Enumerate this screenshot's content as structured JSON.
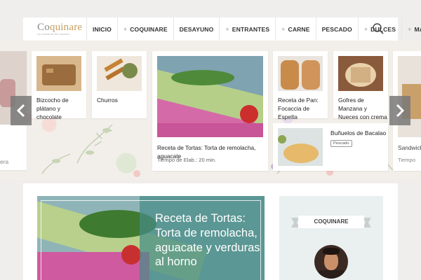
{
  "header": {
    "logo_text_1": "Co",
    "logo_text_2": "quinare",
    "logo_tagline": "La Cocina de Mi Cocinero",
    "nav": [
      {
        "label": "INICIO",
        "plus": false
      },
      {
        "label": "COQUINARE",
        "plus": true
      },
      {
        "label": "DESAYUNO",
        "plus": false
      },
      {
        "label": "ENTRANTES",
        "plus": true
      },
      {
        "label": "CARNE",
        "plus": true
      },
      {
        "label": "PESCADO",
        "plus": false
      },
      {
        "label": "DULCES",
        "plus": true
      },
      {
        "label": "MÁS",
        "plus": true
      }
    ],
    "search_icon": "search-icon"
  },
  "carousel": {
    "left_partial": {
      "title": "era"
    },
    "cards": [
      {
        "title": "Bizcocho de plátano y chocolate"
      },
      {
        "title": "Churros"
      },
      {
        "title": "Receta de Tortas: Torta de remolacha, aguacate",
        "meta": "Tiempo de Elab.: 20 min."
      },
      {
        "title": "Receta de Pan: Focaccia de Espelta"
      },
      {
        "title": "Gofres de Manzana y Nueces con crema"
      },
      {
        "title": "Buñuelos de Bacalao",
        "tag": "Pescado"
      }
    ],
    "right_partial": {
      "title": "Sandwich",
      "meta": "Tiempo"
    },
    "prev_icon": "chevron-left-icon",
    "next_icon": "chevron-right-icon"
  },
  "featured": {
    "title": "Receta de Tortas: Torta de remolacha, aguacate y verduras al horno"
  },
  "sidebar": {
    "ribbon_label": "COQUINARE"
  }
}
